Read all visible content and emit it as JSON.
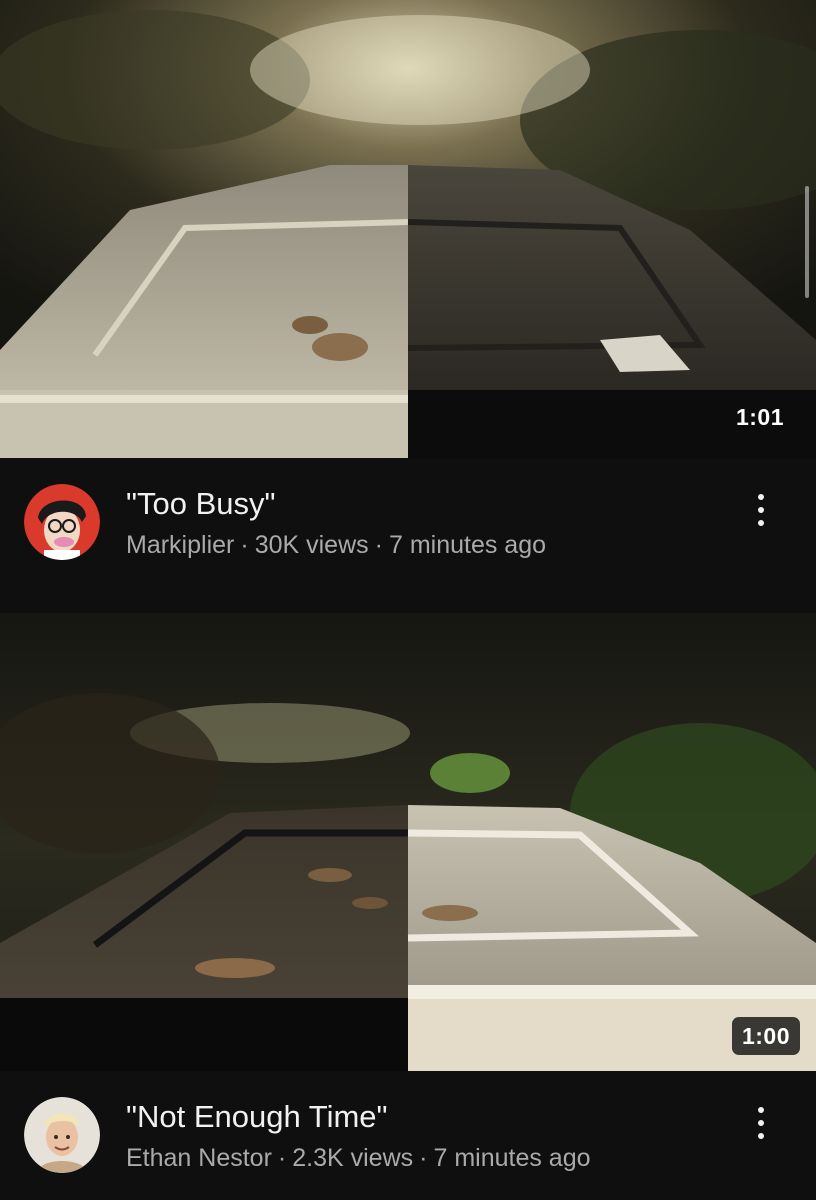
{
  "videos": [
    {
      "title": "\"Too Busy\"",
      "channel": "Markiplier",
      "views": "30K views",
      "age": "7 minutes ago",
      "duration": "1:01",
      "avatar_icon": "markiplier-avatar-icon"
    },
    {
      "title": "\"Not Enough Time\"",
      "channel": "Ethan Nestor",
      "views": "2.3K views",
      "age": "7 minutes ago",
      "duration": "1:00",
      "avatar_icon": "ethan-avatar-icon"
    }
  ],
  "separator": "·",
  "colors": {
    "background": "#0f0f0f",
    "primary_text": "#f1f1f1",
    "secondary_text": "#aaaaaa",
    "markiplier_avatar_bg": "#d93a2b"
  }
}
